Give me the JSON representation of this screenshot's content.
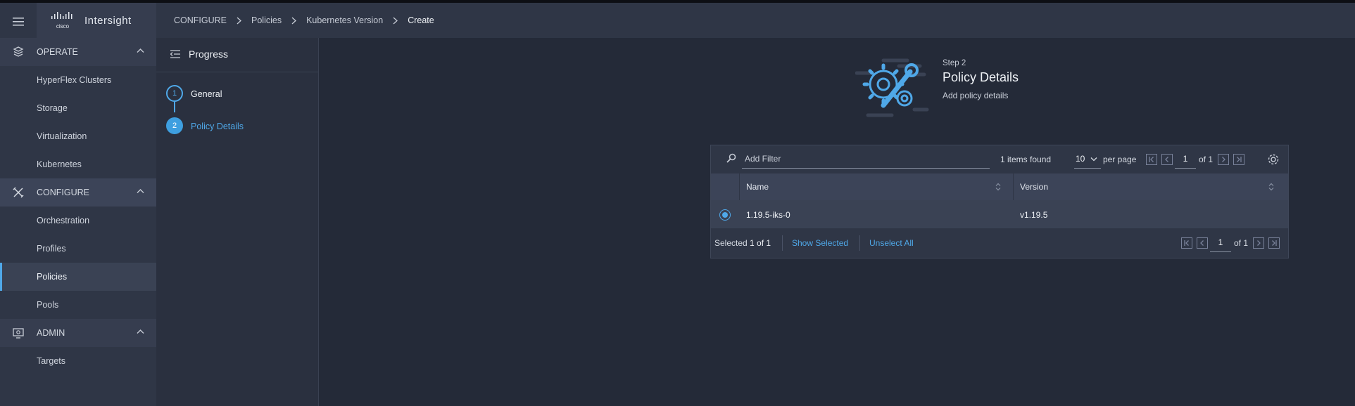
{
  "app": {
    "name": "Intersight",
    "logo": "cisco"
  },
  "breadcrumb": [
    "CONFIGURE",
    "Policies",
    "Kubernetes Version",
    "Create"
  ],
  "sidebar": {
    "sections": [
      {
        "label": "OPERATE",
        "icon": "cube-stack-icon",
        "items": [
          "HyperFlex Clusters",
          "Storage",
          "Virtualization",
          "Kubernetes"
        ]
      },
      {
        "label": "CONFIGURE",
        "icon": "tools-icon",
        "items": [
          "Orchestration",
          "Profiles",
          "Policies",
          "Pools"
        ]
      },
      {
        "label": "ADMIN",
        "icon": "monitor-gear-icon",
        "items": [
          "Targets"
        ]
      }
    ],
    "selected_item": "Policies"
  },
  "progress": {
    "title": "Progress",
    "steps": [
      {
        "number": "1",
        "label": "General"
      },
      {
        "number": "2",
        "label": "Policy Details",
        "active": true
      }
    ]
  },
  "step_header": {
    "step": "Step 2",
    "title": "Policy Details",
    "subtitle": "Add policy details"
  },
  "table": {
    "filter_placeholder": "Add Filter",
    "items_found": "1 items found",
    "per_page_value": "10",
    "per_page_label": "per page",
    "page": "1",
    "of_pages": "of 1",
    "columns": [
      "Name",
      "Version"
    ],
    "rows": [
      {
        "name": "1.19.5-iks-0",
        "version": "v1.19.5",
        "selected": true
      }
    ],
    "selected_prefix": "Selected ",
    "selected_count": "1 of 1",
    "show_selected": "Show Selected",
    "unselect_all": "Unselect All",
    "footer_page": "1",
    "footer_of_pages": "of 1"
  },
  "colors": {
    "accent": "#4fa8e8",
    "background": "#242a38",
    "panel": "#2f3646"
  }
}
